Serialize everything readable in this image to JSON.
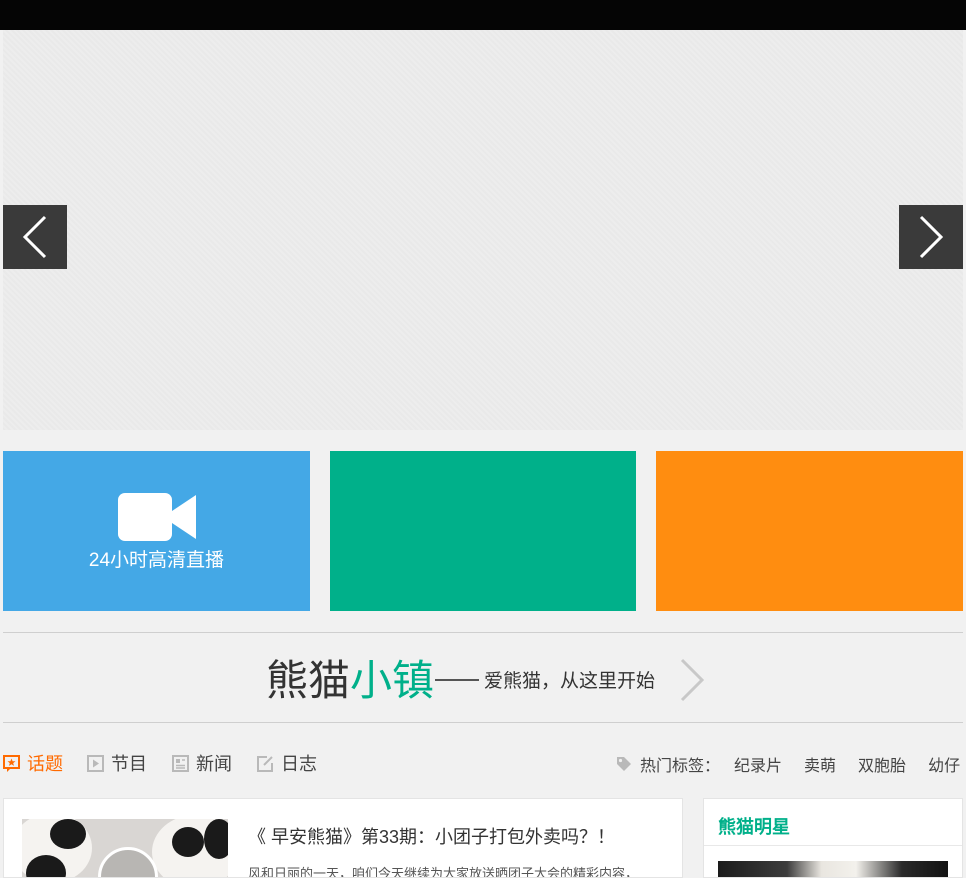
{
  "hero": {
    "prev_icon": "chevron-left-icon",
    "next_icon": "chevron-right-icon"
  },
  "tiles": [
    {
      "label": "24小时高清直播",
      "icon": "video-camera-icon",
      "color": "#44a8e6"
    },
    {
      "label": "",
      "color": "#00b08a"
    },
    {
      "label": "",
      "color": "#ff8d10"
    }
  ],
  "banner": {
    "title_main": "熊猫",
    "title_accent": "小镇",
    "slogan": "爱熊猫，从这里开始"
  },
  "tabs": [
    {
      "label": "话题",
      "icon": "topic-icon",
      "active": true
    },
    {
      "label": "节目",
      "icon": "play-icon"
    },
    {
      "label": "新闻",
      "icon": "news-icon"
    },
    {
      "label": "日志",
      "icon": "edit-icon"
    }
  ],
  "hot_tags": {
    "label": "热门标签：",
    "items": [
      "纪录片",
      "卖萌",
      "双胞胎",
      "幼仔"
    ]
  },
  "article": {
    "title": "《 早安熊猫》第33期：小团子打包外卖吗？！",
    "excerpt": "风和日丽的一天，咱们今天继续为大家放送晒团子大会的精彩内容，"
  },
  "sidebar": {
    "title": "熊猫明星"
  },
  "colors": {
    "accent_green": "#00b08a",
    "accent_orange": "#ff6a00",
    "tile_blue": "#44a8e6",
    "tile_orange": "#ff8d10"
  }
}
